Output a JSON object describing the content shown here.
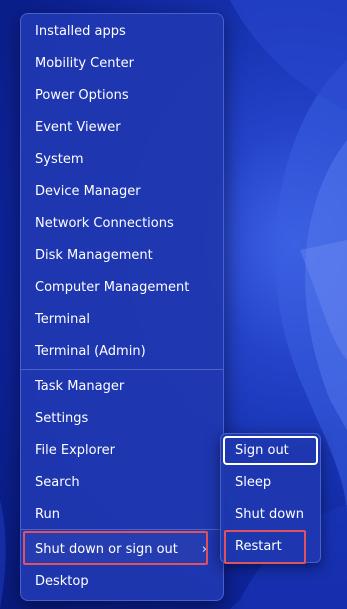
{
  "menu": {
    "items": [
      {
        "label": "Installed apps"
      },
      {
        "label": "Mobility Center"
      },
      {
        "label": "Power Options"
      },
      {
        "label": "Event Viewer"
      },
      {
        "label": "System"
      },
      {
        "label": "Device Manager"
      },
      {
        "label": "Network Connections"
      },
      {
        "label": "Disk Management"
      },
      {
        "label": "Computer Management"
      },
      {
        "label": "Terminal"
      },
      {
        "label": "Terminal (Admin)"
      },
      {
        "label": "Task Manager"
      },
      {
        "label": "Settings"
      },
      {
        "label": "File Explorer"
      },
      {
        "label": "Search"
      },
      {
        "label": "Run"
      },
      {
        "label": "Shut down or sign out",
        "chevron": "›"
      },
      {
        "label": "Desktop"
      }
    ]
  },
  "submenu": {
    "items": [
      {
        "label": "Sign out"
      },
      {
        "label": "Sleep"
      },
      {
        "label": "Shut down"
      },
      {
        "label": "Restart"
      }
    ]
  },
  "colors": {
    "highlight_border": "#e0525e",
    "menu_background": "#1f38b0",
    "wallpaper": "#0b1d8a"
  }
}
